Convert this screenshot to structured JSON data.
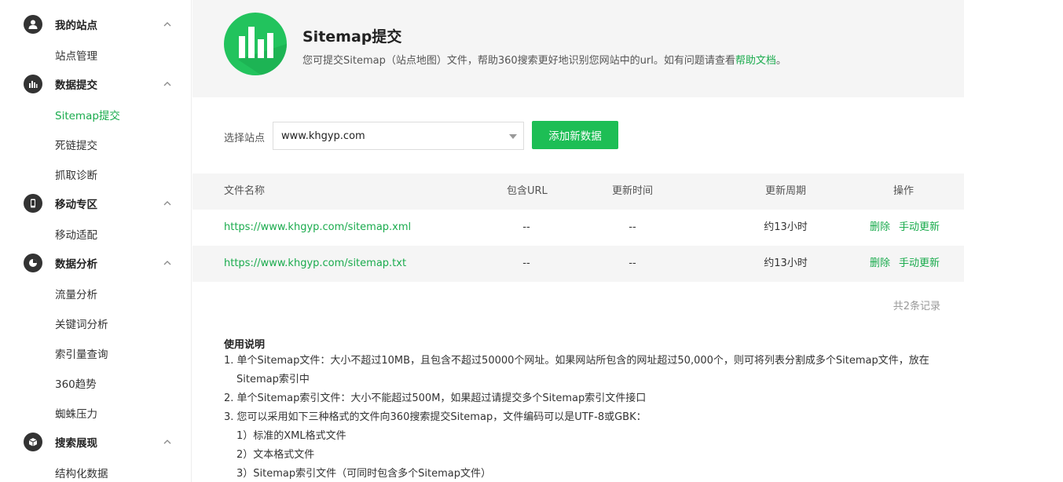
{
  "sidebar": {
    "groups": [
      {
        "label": "我的站点",
        "icon": "user-icon",
        "items": [
          "站点管理"
        ]
      },
      {
        "label": "数据提交",
        "icon": "bar-chart-icon",
        "items": [
          "Sitemap提交",
          "死链提交",
          "抓取诊断"
        ]
      },
      {
        "label": "移动专区",
        "icon": "mobile-icon",
        "items": [
          "移动适配"
        ]
      },
      {
        "label": "数据分析",
        "icon": "pie-chart-icon",
        "items": [
          "流量分析",
          "关键词分析",
          "索引量查询",
          "360趋势",
          "蜘蛛压力"
        ]
      },
      {
        "label": "搜索展现",
        "icon": "cube-icon",
        "items": [
          "结构化数据"
        ]
      }
    ],
    "active_item": "Sitemap提交"
  },
  "header": {
    "title": "Sitemap提交",
    "desc_pre": "您可提交Sitemap（站点地图）文件，帮助360搜索更好地识别您网站中的url。如有问题请查看",
    "desc_link": "帮助文档",
    "desc_post": "。"
  },
  "selector": {
    "label": "选择站点",
    "value": "www.khgyp.com",
    "add_button": "添加新数据"
  },
  "table": {
    "columns": [
      "文件名称",
      "包含URL",
      "更新时间",
      "更新周期",
      "操作"
    ],
    "rows": [
      {
        "file": "https://www.khgyp.com/sitemap.xml",
        "urls": "--",
        "time": "--",
        "cycle": "约13小时",
        "op_delete": "删除",
        "op_update": "手动更新"
      },
      {
        "file": "https://www.khgyp.com/sitemap.txt",
        "urls": "--",
        "time": "--",
        "cycle": "约13小时",
        "op_delete": "删除",
        "op_update": "手动更新"
      }
    ],
    "total": "共2条记录"
  },
  "instructions": {
    "title": "使用说明",
    "lines": [
      "1. 单个Sitemap文件：大小不超过10MB，且包含不超过50000个网址。如果网站所包含的网址超过50,000个，则可将列表分割成多个Sitemap文件，放在",
      "Sitemap索引中",
      "2. 单个Sitemap索引文件：大小不能超过500M，如果超过请提交多个Sitemap索引文件接口",
      "3. 您可以采用如下三种格式的文件向360搜索提交Sitemap，文件编码可以是UTF-8或GBK：",
      "1）标准的XML格式文件",
      "2）文本格式文件",
      "3）Sitemap索引文件（可同时包含多个Sitemap文件）"
    ]
  },
  "colors": {
    "accent": "#1aab4d",
    "button": "#1dbe55",
    "logo": "#22c35d"
  }
}
